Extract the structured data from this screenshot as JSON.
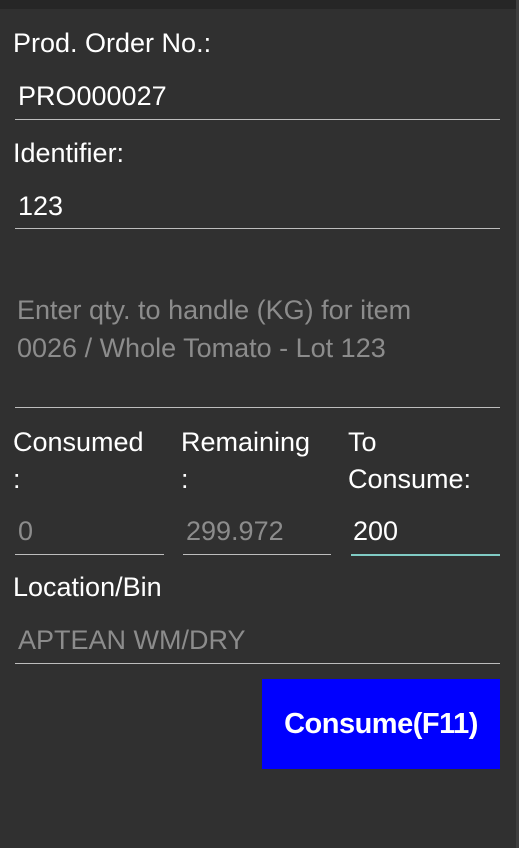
{
  "form": {
    "prod_order_label": "Prod. Order No.:",
    "prod_order_value": "PRO000027",
    "identifier_label": "Identifier:",
    "identifier_value": "123",
    "qty_hint_line1": "Enter qty. to handle (KG) for item",
    "qty_hint_line2": "0026 / Whole Tomato  - Lot 123",
    "consumed_label_line1": "Consumed",
    "consumed_label_line2": ":",
    "consumed_value": "0",
    "remaining_label_line1": "Remaining",
    "remaining_label_line2": ":",
    "remaining_value": "299.972",
    "to_consume_label_line1": "To",
    "to_consume_label_line2": "Consume:",
    "to_consume_value": "200",
    "location_label": "Location/Bin",
    "location_value": "APTEAN WM/DRY",
    "consume_button_label": "Consume(F11)"
  },
  "colors": {
    "background": "#303030",
    "button": "#0000ff",
    "focus_underline": "#80cbc4",
    "disabled_text": "#8c8c8c"
  }
}
